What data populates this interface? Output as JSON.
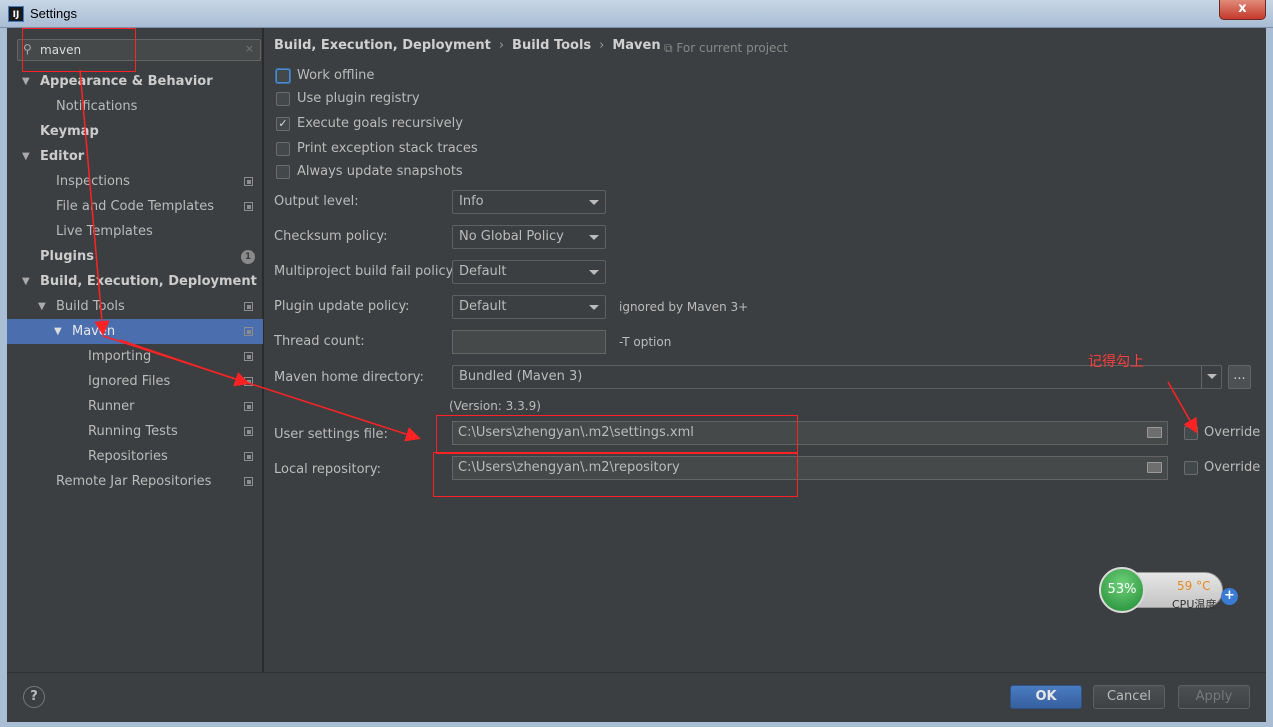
{
  "window": {
    "title": "Settings",
    "icon": "intellij-icon",
    "close_label": "x"
  },
  "search": {
    "value": "maven",
    "clear_label": "×"
  },
  "sidebar": {
    "items": [
      {
        "label": "Appearance & Behavior"
      },
      {
        "label": "Notifications"
      },
      {
        "label": "Keymap"
      },
      {
        "label": "Editor"
      },
      {
        "label": "Inspections"
      },
      {
        "label": "File and Code Templates"
      },
      {
        "label": "Live Templates"
      },
      {
        "label": "Plugins",
        "badge": "1"
      },
      {
        "label": "Build, Execution, Deployment"
      },
      {
        "label": "Build Tools"
      },
      {
        "label": "Maven"
      },
      {
        "label": "Importing"
      },
      {
        "label": "Ignored Files"
      },
      {
        "label": "Runner"
      },
      {
        "label": "Running Tests"
      },
      {
        "label": "Repositories"
      },
      {
        "label": "Remote Jar Repositories"
      }
    ]
  },
  "breadcrumb": {
    "part1": "Build, Execution, Deployment",
    "part2": "Build Tools",
    "part3": "Maven",
    "scope": "For current project"
  },
  "checkboxes": [
    {
      "label": "Work offline",
      "checked": false
    },
    {
      "label": "Use plugin registry",
      "checked": false
    },
    {
      "label": "Execute goals recursively",
      "checked": true
    },
    {
      "label": "Print exception stack traces",
      "checked": false
    },
    {
      "label": "Always update snapshots",
      "checked": false
    }
  ],
  "form": {
    "output_level": {
      "label": "Output level:",
      "value": "Info"
    },
    "checksum_policy": {
      "label": "Checksum policy:",
      "value": "No Global Policy"
    },
    "multiproject_fail": {
      "label": "Multiproject build fail policy:",
      "value": "Default"
    },
    "plugin_update": {
      "label": "Plugin update policy:",
      "value": "Default",
      "hint": "ignored by Maven 3+"
    },
    "thread_count": {
      "label": "Thread count:",
      "value": "",
      "hint": "-T option"
    },
    "maven_home": {
      "label": "Maven home directory:",
      "value": "Bundled (Maven 3)",
      "version": "(Version: 3.3.9)",
      "browse": "..."
    },
    "user_settings": {
      "label": "User settings file:",
      "value": "C:\\Users\\zhengyan\\.m2\\settings.xml",
      "override": "Override"
    },
    "local_repo": {
      "label": "Local repository:",
      "value": "C:\\Users\\zhengyan\\.m2\\repository",
      "override": "Override"
    }
  },
  "annotation": {
    "text": "记得勾上"
  },
  "buttons": {
    "help": "?",
    "ok": "OK",
    "cancel": "Cancel",
    "apply": "Apply"
  },
  "cpu": {
    "percent": "53%",
    "temp": "59 °C",
    "label": "CPU温度",
    "plus": "+"
  },
  "colors": {
    "selection": "#4b6eaf",
    "annotation": "#ff2222",
    "primary_button": "#4a7cc2"
  }
}
